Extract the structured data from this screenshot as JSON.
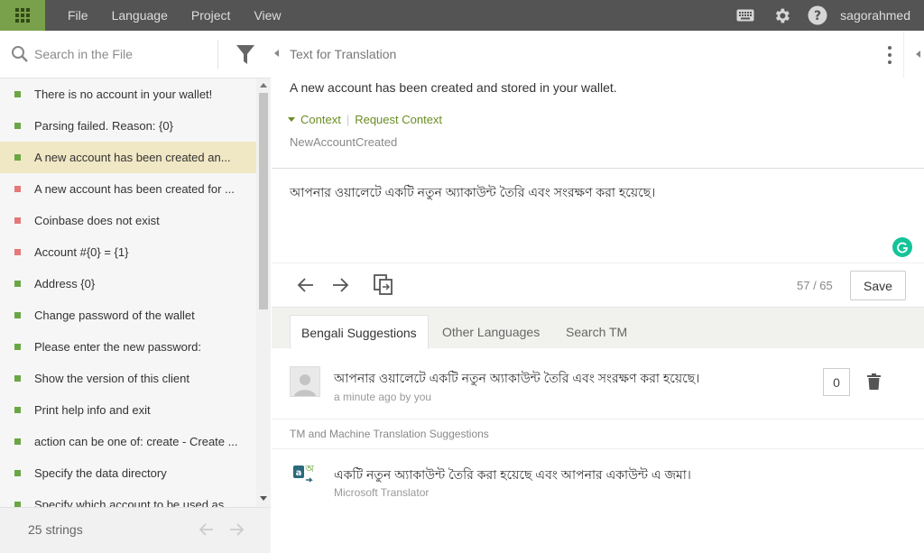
{
  "topbar": {
    "menu": [
      "File",
      "Language",
      "Project",
      "View"
    ],
    "username": "sagorahmed",
    "icons": [
      "keyboard-icon",
      "gear-icon",
      "help-icon"
    ]
  },
  "search": {
    "placeholder": "Search in the File"
  },
  "strings": [
    {
      "text": "There is no account in your wallet!",
      "status": "translated"
    },
    {
      "text": "Parsing failed. Reason: {0}",
      "status": "translated"
    },
    {
      "text": "A new account has been created an...",
      "status": "translated",
      "selected": true
    },
    {
      "text": "A new account has been created for ...",
      "status": "untranslated"
    },
    {
      "text": "Coinbase does not exist",
      "status": "untranslated"
    },
    {
      "text": "Account #{0} = {1}",
      "status": "untranslated"
    },
    {
      "text": "Address {0}",
      "status": "translated"
    },
    {
      "text": "Change password of the wallet",
      "status": "translated"
    },
    {
      "text": "Please enter the new password:",
      "status": "translated"
    },
    {
      "text": "Show the version of this client",
      "status": "translated"
    },
    {
      "text": "Print help info and exit",
      "status": "translated"
    },
    {
      "text": "action can be one of: create - Create ...",
      "status": "translated"
    },
    {
      "text": "Specify the data directory",
      "status": "translated"
    },
    {
      "text": "Specify which account to be used as",
      "status": "translated"
    }
  ],
  "footer": {
    "count": "25 strings"
  },
  "editor": {
    "header_title": "Text for Translation",
    "source": "A new account has been created and stored in your wallet.",
    "context_label": "Context",
    "request_context_label": "Request Context",
    "context_key": "NewAccountCreated",
    "translation": "আপনার ওয়ালেটে একটি নতুন অ্যাকাউন্ট তৈরি এবং সংরক্ষণ করা হয়েছে।",
    "progress": "57 / 65",
    "save_label": "Save"
  },
  "tabs": [
    "Bengali Suggestions",
    "Other Languages",
    "Search TM"
  ],
  "suggestion": {
    "text": "আপনার ওয়ালেটে একটি নতুন অ্যাকাউন্ট তৈরি এবং সংরক্ষণ করা হয়েছে।",
    "meta": "a minute ago by you",
    "votes": "0"
  },
  "mt": {
    "heading": "TM and Machine Translation Suggestions",
    "text": "একটি নতুন অ্যাকাউন্ট তৈরি করা হয়েছে এবং আপনার একাউন্ট এ জমা।",
    "source": "Microsoft Translator"
  },
  "colors": {
    "topbar": "#545454",
    "apps_button": "#79a04a",
    "translated": "#6aa744",
    "untranslated": "#e57878",
    "selected_row": "#f0e7c4",
    "context_link": "#6b8e23"
  }
}
